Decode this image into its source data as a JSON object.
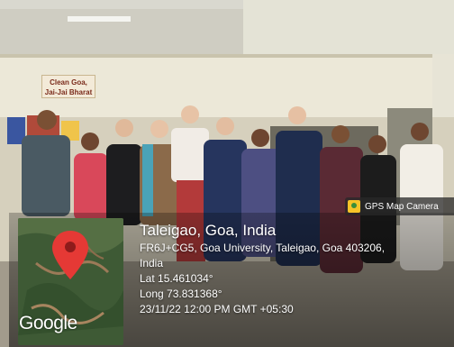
{
  "sign": {
    "line1": "Clean Goa,",
    "line2": "Jai-Jai Bharat"
  },
  "badge": {
    "label": "GPS Map Camera",
    "icon": "gps-map-camera-icon"
  },
  "map": {
    "logo_text": "Google",
    "marker_color": "#e53935"
  },
  "location": {
    "title": "Taleigao, Goa, India",
    "address_line1": "FR6J+CG5, Goa University, Taleigao, Goa 403206,",
    "address_line2": "India",
    "lat": "Lat 15.461034°",
    "long": "Long 73.831368°",
    "datetime": "23/11/22 12:00 PM GMT +05:30"
  }
}
